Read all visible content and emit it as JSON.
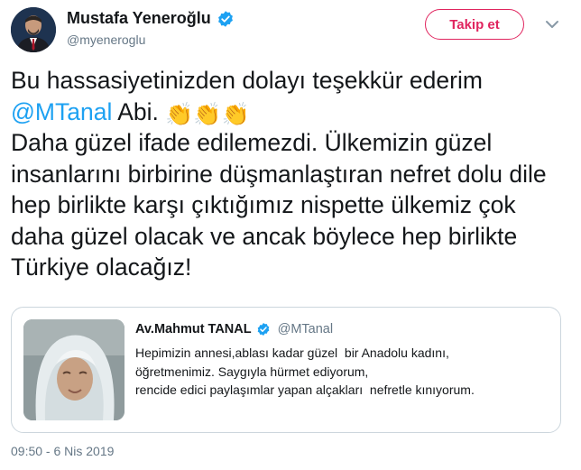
{
  "author": {
    "name": "Mustafa Yeneroğlu",
    "handle": "@myeneroglu",
    "verified": true
  },
  "follow_button": {
    "label": "Takip et",
    "color": "#e0245e"
  },
  "tweet": {
    "line1": "Bu hassasiyetinizden dolayı teşekkür ederim",
    "mention": "@MTanal",
    "after_mention": " Abi. ",
    "claps": "👏👏👏",
    "body": "Daha güzel ifade edilemezdi. Ülkemizin güzel insanlarını birbirine düşmanlaştıran nefret dolu dile hep birlikte karşı çıktığımız nispette ülkemiz çok daha güzel olacak ve ancak böylece hep birlikte Türkiye olacağız!"
  },
  "quoted_tweet": {
    "name": "Av.Mahmut TANAL",
    "handle": "@MTanal",
    "verified": true,
    "lines": [
      "Hepimizin annesi,ablası kadar güzel  bir Anadolu kadını,",
      "öğretmenimiz. Saygıyla hürmet ediyorum,",
      "rencide edici paylaşımlar yapan alçakları  nefretle kınıyorum."
    ]
  },
  "timestamp": "09:50 - 6 Nis 2019",
  "colors": {
    "link": "#1da1f2",
    "secondary_text": "#657786",
    "border": "#ccd6dd"
  },
  "icons": [
    "verified-badge-icon",
    "chevron-down-icon",
    "clap-emoji"
  ]
}
